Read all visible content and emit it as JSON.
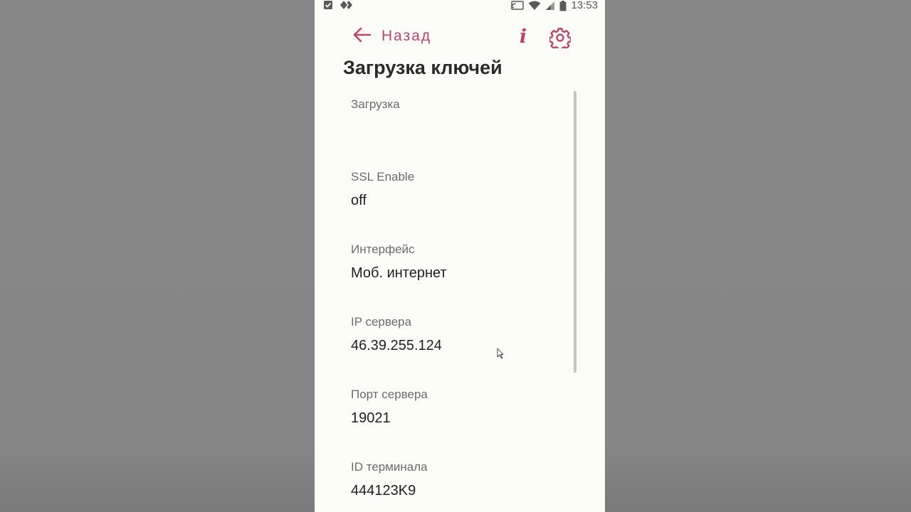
{
  "status_bar": {
    "time": "13:53",
    "left_icons": [
      "checkbox-notification-icon",
      "diamond-app-icon"
    ],
    "right_icons": [
      "cast-icon",
      "wifi-icon",
      "signal-icon",
      "battery-icon"
    ]
  },
  "toolbar": {
    "back_label": "Назад",
    "info_label": "i"
  },
  "page": {
    "title": "Загрузка ключей"
  },
  "settings": [
    {
      "label": "Загрузка",
      "value": ""
    },
    {
      "label": "SSL Enable",
      "value": "off"
    },
    {
      "label": "Интерфейс",
      "value": "Моб. интернет"
    },
    {
      "label": "IP сервера",
      "value": "46.39.255.124"
    },
    {
      "label": "Порт сервера",
      "value": "19021"
    },
    {
      "label": "ID терминала",
      "value": "444123K9"
    }
  ],
  "colors": {
    "accent": "#c2426b",
    "background": "#fdfdf8",
    "title": "#2b2b2b",
    "label": "#6b6b6b",
    "value": "#1f1f1f"
  }
}
